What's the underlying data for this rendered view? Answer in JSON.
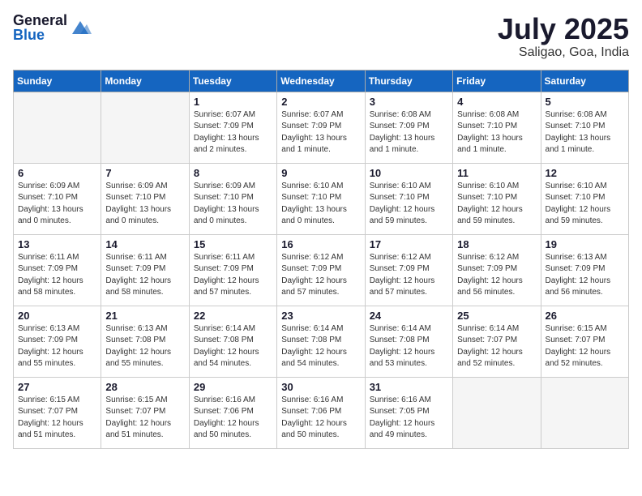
{
  "header": {
    "logo_general": "General",
    "logo_blue": "Blue",
    "title": "July 2025",
    "location": "Saligao, Goa, India"
  },
  "weekdays": [
    "Sunday",
    "Monday",
    "Tuesday",
    "Wednesday",
    "Thursday",
    "Friday",
    "Saturday"
  ],
  "weeks": [
    [
      {
        "day": "",
        "info": ""
      },
      {
        "day": "",
        "info": ""
      },
      {
        "day": "1",
        "info": "Sunrise: 6:07 AM\nSunset: 7:09 PM\nDaylight: 13 hours and 2 minutes."
      },
      {
        "day": "2",
        "info": "Sunrise: 6:07 AM\nSunset: 7:09 PM\nDaylight: 13 hours and 1 minute."
      },
      {
        "day": "3",
        "info": "Sunrise: 6:08 AM\nSunset: 7:09 PM\nDaylight: 13 hours and 1 minute."
      },
      {
        "day": "4",
        "info": "Sunrise: 6:08 AM\nSunset: 7:10 PM\nDaylight: 13 hours and 1 minute."
      },
      {
        "day": "5",
        "info": "Sunrise: 6:08 AM\nSunset: 7:10 PM\nDaylight: 13 hours and 1 minute."
      }
    ],
    [
      {
        "day": "6",
        "info": "Sunrise: 6:09 AM\nSunset: 7:10 PM\nDaylight: 13 hours and 0 minutes."
      },
      {
        "day": "7",
        "info": "Sunrise: 6:09 AM\nSunset: 7:10 PM\nDaylight: 13 hours and 0 minutes."
      },
      {
        "day": "8",
        "info": "Sunrise: 6:09 AM\nSunset: 7:10 PM\nDaylight: 13 hours and 0 minutes."
      },
      {
        "day": "9",
        "info": "Sunrise: 6:10 AM\nSunset: 7:10 PM\nDaylight: 13 hours and 0 minutes."
      },
      {
        "day": "10",
        "info": "Sunrise: 6:10 AM\nSunset: 7:10 PM\nDaylight: 12 hours and 59 minutes."
      },
      {
        "day": "11",
        "info": "Sunrise: 6:10 AM\nSunset: 7:10 PM\nDaylight: 12 hours and 59 minutes."
      },
      {
        "day": "12",
        "info": "Sunrise: 6:10 AM\nSunset: 7:10 PM\nDaylight: 12 hours and 59 minutes."
      }
    ],
    [
      {
        "day": "13",
        "info": "Sunrise: 6:11 AM\nSunset: 7:09 PM\nDaylight: 12 hours and 58 minutes."
      },
      {
        "day": "14",
        "info": "Sunrise: 6:11 AM\nSunset: 7:09 PM\nDaylight: 12 hours and 58 minutes."
      },
      {
        "day": "15",
        "info": "Sunrise: 6:11 AM\nSunset: 7:09 PM\nDaylight: 12 hours and 57 minutes."
      },
      {
        "day": "16",
        "info": "Sunrise: 6:12 AM\nSunset: 7:09 PM\nDaylight: 12 hours and 57 minutes."
      },
      {
        "day": "17",
        "info": "Sunrise: 6:12 AM\nSunset: 7:09 PM\nDaylight: 12 hours and 57 minutes."
      },
      {
        "day": "18",
        "info": "Sunrise: 6:12 AM\nSunset: 7:09 PM\nDaylight: 12 hours and 56 minutes."
      },
      {
        "day": "19",
        "info": "Sunrise: 6:13 AM\nSunset: 7:09 PM\nDaylight: 12 hours and 56 minutes."
      }
    ],
    [
      {
        "day": "20",
        "info": "Sunrise: 6:13 AM\nSunset: 7:09 PM\nDaylight: 12 hours and 55 minutes."
      },
      {
        "day": "21",
        "info": "Sunrise: 6:13 AM\nSunset: 7:08 PM\nDaylight: 12 hours and 55 minutes."
      },
      {
        "day": "22",
        "info": "Sunrise: 6:14 AM\nSunset: 7:08 PM\nDaylight: 12 hours and 54 minutes."
      },
      {
        "day": "23",
        "info": "Sunrise: 6:14 AM\nSunset: 7:08 PM\nDaylight: 12 hours and 54 minutes."
      },
      {
        "day": "24",
        "info": "Sunrise: 6:14 AM\nSunset: 7:08 PM\nDaylight: 12 hours and 53 minutes."
      },
      {
        "day": "25",
        "info": "Sunrise: 6:14 AM\nSunset: 7:07 PM\nDaylight: 12 hours and 52 minutes."
      },
      {
        "day": "26",
        "info": "Sunrise: 6:15 AM\nSunset: 7:07 PM\nDaylight: 12 hours and 52 minutes."
      }
    ],
    [
      {
        "day": "27",
        "info": "Sunrise: 6:15 AM\nSunset: 7:07 PM\nDaylight: 12 hours and 51 minutes."
      },
      {
        "day": "28",
        "info": "Sunrise: 6:15 AM\nSunset: 7:07 PM\nDaylight: 12 hours and 51 minutes."
      },
      {
        "day": "29",
        "info": "Sunrise: 6:16 AM\nSunset: 7:06 PM\nDaylight: 12 hours and 50 minutes."
      },
      {
        "day": "30",
        "info": "Sunrise: 6:16 AM\nSunset: 7:06 PM\nDaylight: 12 hours and 50 minutes."
      },
      {
        "day": "31",
        "info": "Sunrise: 6:16 AM\nSunset: 7:05 PM\nDaylight: 12 hours and 49 minutes."
      },
      {
        "day": "",
        "info": ""
      },
      {
        "day": "",
        "info": ""
      }
    ]
  ]
}
